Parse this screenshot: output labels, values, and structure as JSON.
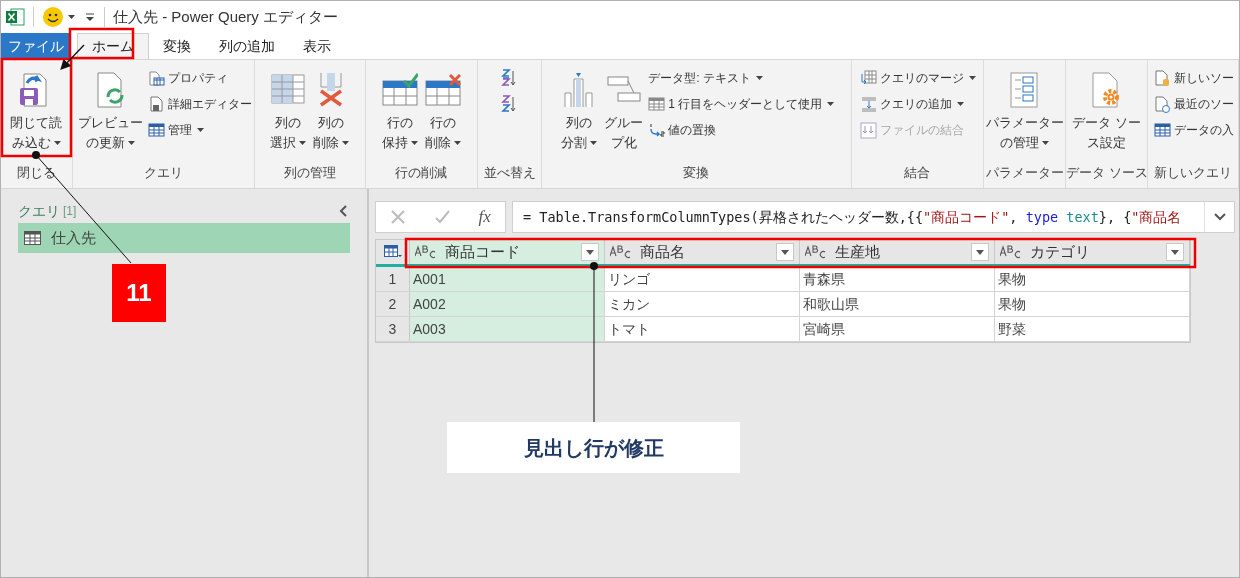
{
  "window": {
    "title": "仕入先 - Power Query エディター"
  },
  "tabs": [
    {
      "label": "ファイル",
      "kind": "file",
      "selected": false
    },
    {
      "label": "ホーム",
      "kind": "tab",
      "selected": true
    },
    {
      "label": "変換",
      "kind": "tab",
      "selected": false
    },
    {
      "label": "列の追加",
      "kind": "tab",
      "selected": false
    },
    {
      "label": "表示",
      "kind": "tab",
      "selected": false
    }
  ],
  "ribbon": {
    "groups": [
      {
        "label": "閉じる",
        "items": [
          {
            "kind": "large",
            "lines": [
              "閉じて読",
              "み込む"
            ],
            "dropdown": true
          }
        ]
      },
      {
        "label": "クエリ",
        "items": [
          {
            "kind": "large",
            "lines": [
              "プレビュー",
              "の更新"
            ],
            "dropdown": true
          },
          {
            "kind": "small",
            "label": "プロパティ",
            "dropdown": false,
            "disabled": false
          },
          {
            "kind": "small",
            "label": "詳細エディター",
            "dropdown": false,
            "disabled": false
          },
          {
            "kind": "small",
            "label": "管理",
            "dropdown": true,
            "disabled": false
          }
        ]
      },
      {
        "label": "列の管理",
        "items": [
          {
            "kind": "large",
            "lines": [
              "列の",
              "選択"
            ],
            "dropdown": true
          },
          {
            "kind": "large",
            "lines": [
              "列の",
              "削除"
            ],
            "dropdown": true
          }
        ]
      },
      {
        "label": "行の削減",
        "items": [
          {
            "kind": "large",
            "lines": [
              "行の",
              "保持"
            ],
            "dropdown": true
          },
          {
            "kind": "large",
            "lines": [
              "行の",
              "削除"
            ],
            "dropdown": true
          }
        ]
      },
      {
        "label": "並べ替え",
        "items": [
          {
            "kind": "icon"
          },
          {
            "kind": "icon"
          }
        ]
      },
      {
        "label": "変換",
        "items": [
          {
            "kind": "large",
            "lines": [
              "列の",
              "分割"
            ],
            "dropdown": true
          },
          {
            "kind": "large",
            "lines": [
              "グルー",
              "プ化"
            ],
            "dropdown": false
          },
          {
            "kind": "small",
            "label": "データ型: テキスト",
            "dropdown": true,
            "disabled": false
          },
          {
            "kind": "small",
            "label": "1 行目をヘッダーとして使用",
            "dropdown": true,
            "disabled": false
          },
          {
            "kind": "small",
            "label": "値の置換",
            "dropdown": false,
            "disabled": false
          }
        ]
      },
      {
        "label": "結合",
        "items": [
          {
            "kind": "small",
            "label": "クエリのマージ",
            "dropdown": true,
            "disabled": false
          },
          {
            "kind": "small",
            "label": "クエリの追加",
            "dropdown": true,
            "disabled": false
          },
          {
            "kind": "small",
            "label": "ファイルの結合",
            "dropdown": false,
            "disabled": true
          }
        ]
      },
      {
        "label": "パラメーター",
        "items": [
          {
            "kind": "large",
            "lines": [
              "パラメーター",
              "の管理"
            ],
            "dropdown": true
          }
        ]
      },
      {
        "label": "データ ソース",
        "items": [
          {
            "kind": "large",
            "lines": [
              "データ ソー",
              "ス設定"
            ],
            "dropdown": false
          }
        ]
      },
      {
        "label": "新しいクエリ",
        "items": [
          {
            "kind": "small",
            "label": "新しいソー",
            "dropdown": false,
            "disabled": false
          },
          {
            "kind": "small",
            "label": "最近のソー",
            "dropdown": false,
            "disabled": false
          },
          {
            "kind": "small",
            "label": "データの入",
            "dropdown": false,
            "disabled": false
          }
        ]
      }
    ]
  },
  "queries_pane": {
    "title": "クエリ",
    "count": "[1]",
    "items": [
      {
        "label": "仕入先",
        "selected": true
      }
    ]
  },
  "formula_bar": {
    "fx": "fx",
    "tokens": [
      {
        "text": "= Table.TransformColumnTypes(昇格されたヘッダー数,{{",
        "kind": "plain"
      },
      {
        "text": "\"商品コード\"",
        "kind": "string"
      },
      {
        "text": ", ",
        "kind": "plain"
      },
      {
        "text": "type",
        "kind": "keyword"
      },
      {
        "text": " text",
        "kind": "type"
      },
      {
        "text": "}, {",
        "kind": "plain"
      },
      {
        "text": "\"商品名",
        "kind": "string"
      }
    ]
  },
  "table": {
    "columns": [
      {
        "name": "商品コード",
        "selected": true
      },
      {
        "name": "商品名",
        "selected": false
      },
      {
        "name": "生産地",
        "selected": false
      },
      {
        "name": "カテゴリ",
        "selected": false
      }
    ],
    "rows": [
      {
        "number": "1",
        "cells": [
          "A001",
          "リンゴ",
          "青森県",
          "果物"
        ]
      },
      {
        "number": "2",
        "cells": [
          "A002",
          "ミカン",
          "和歌山県",
          "果物"
        ]
      },
      {
        "number": "3",
        "cells": [
          "A003",
          "トマト",
          "宮崎県",
          "野菜"
        ]
      }
    ]
  },
  "annotations": {
    "badge": "11",
    "callout": "見出し行が修正"
  }
}
